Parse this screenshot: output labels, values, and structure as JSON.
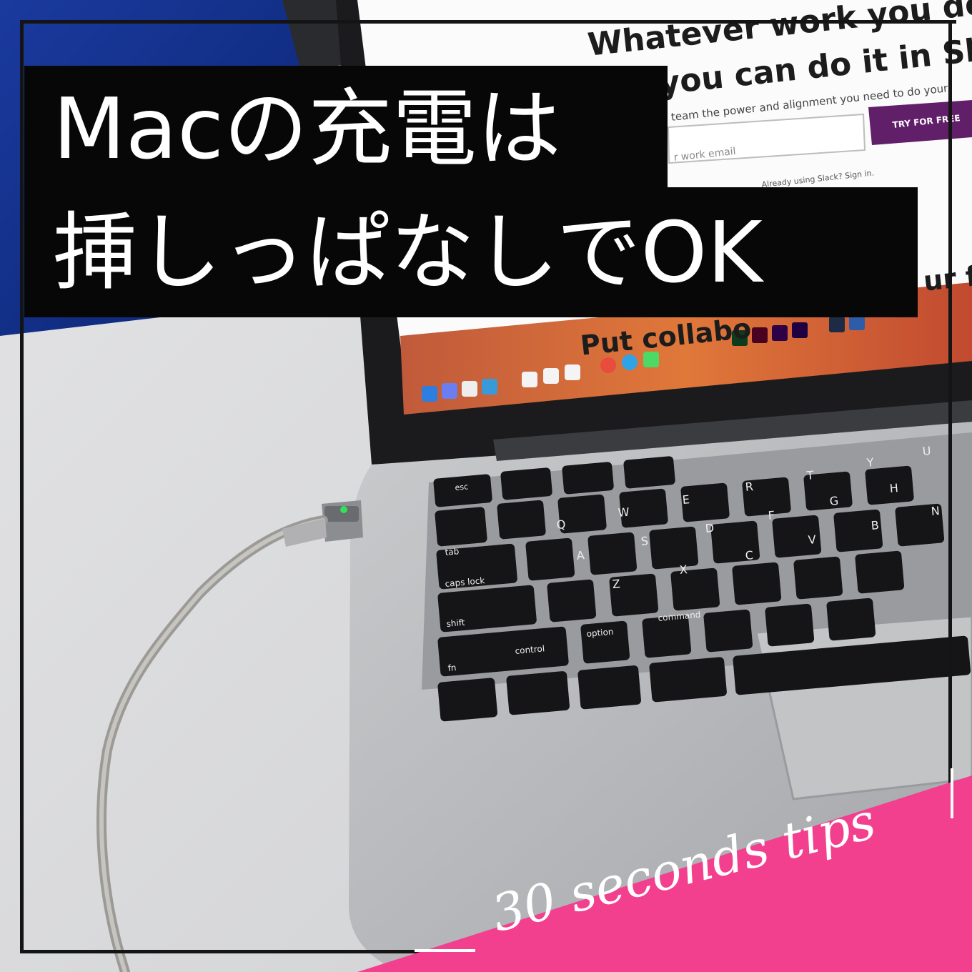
{
  "title": {
    "line1": "Macの充電は",
    "line2": "挿しっぱなしでOK"
  },
  "tag": {
    "label": "30 seconds tips",
    "color": "#f23f8e"
  },
  "screen": {
    "headline_line1": "Whatever work you do,",
    "headline_line2": "you can do it in Slack",
    "subline": "team the power and alignment you need to do your",
    "email_placeholder": "r work email",
    "cta_button": "TRY FOR FREE",
    "signin_line": "Already using Slack? Sign in.",
    "lower_heading": "Put collabo",
    "lower_heading_right": "ur fin"
  },
  "keyboard": {
    "keys": [
      "esc",
      "tab",
      "caps lock",
      "shift",
      "fn",
      "control",
      "option",
      "command",
      "Q",
      "W",
      "E",
      "R",
      "T",
      "Y",
      "U",
      "A",
      "S",
      "D",
      "F",
      "G",
      "H",
      "Z",
      "X",
      "C",
      "V",
      "B",
      "N"
    ]
  },
  "colors": {
    "title_bg": "#070707",
    "accent_pink": "#f23f8e",
    "cta_purple": "#611f69"
  }
}
